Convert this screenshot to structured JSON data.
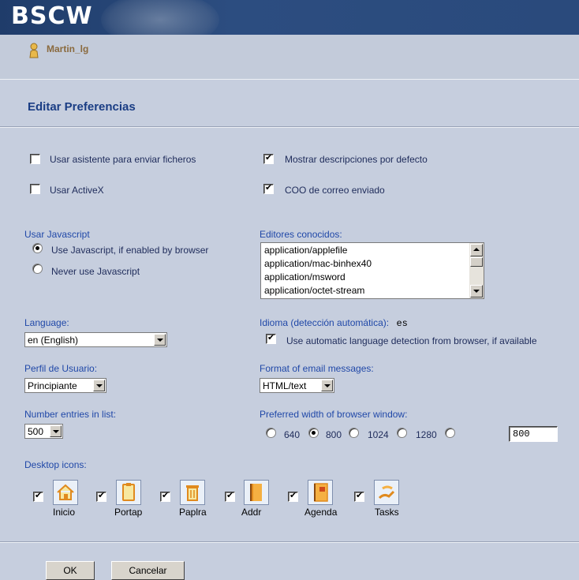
{
  "header": {
    "logo": "BSCW"
  },
  "user": {
    "name": "Martin_lg"
  },
  "page": {
    "title": "Editar Preferencias"
  },
  "options": {
    "upload_assistant": {
      "label": "Usar asistente para enviar ficheros",
      "checked": false
    },
    "activex": {
      "label": "Usar ActiveX",
      "checked": false
    },
    "show_descriptions": {
      "label": "Mostrar descripciones por defecto",
      "checked": true
    },
    "coo_mail": {
      "label": "COO de correo enviado",
      "checked": true
    }
  },
  "javascript": {
    "label": "Usar Javascript",
    "options": [
      {
        "label": "Use Javascript, if enabled by browser",
        "selected": true
      },
      {
        "label": "Never use Javascript",
        "selected": false
      }
    ]
  },
  "editors": {
    "label": "Editores conocidos:",
    "items": [
      "application/applefile",
      "application/mac-binhex40",
      "application/msword",
      "application/octet-stream"
    ]
  },
  "language": {
    "label": "Language:",
    "value": "en (English)"
  },
  "idioma": {
    "label": "Idioma (detección automática):",
    "value": "es",
    "auto_label": "Use automatic language detection from browser, if available",
    "auto_checked": true
  },
  "profile": {
    "label": "Perfil de Usuario:",
    "value": "Principiante"
  },
  "email_format": {
    "label": "Format of email messages:",
    "value": "HTML/text"
  },
  "entries": {
    "label": "Number entries in list:",
    "value": "500"
  },
  "browser_width": {
    "label": "Preferred width of browser window:",
    "options": [
      "640",
      "800",
      "1024",
      "1280"
    ],
    "selected": "800",
    "custom_value": "800"
  },
  "desktop_icons": {
    "label": "Desktop icons:",
    "items": [
      {
        "label": "Inicio",
        "icon": "home-icon",
        "checked": true
      },
      {
        "label": "Portap",
        "icon": "clipboard-icon",
        "checked": true
      },
      {
        "label": "Paplra",
        "icon": "trash-icon",
        "checked": true
      },
      {
        "label": "Addr",
        "icon": "address-book-icon",
        "checked": true
      },
      {
        "label": "Agenda",
        "icon": "agenda-icon",
        "checked": true
      },
      {
        "label": "Tasks",
        "icon": "tasks-icon",
        "checked": true
      }
    ]
  },
  "buttons": {
    "ok": "OK",
    "cancel": "Cancelar"
  },
  "colors": {
    "header": "#2a4a7c",
    "background": "#c6cede",
    "accent_blue": "#2048a8",
    "title": "#1a3d84"
  }
}
